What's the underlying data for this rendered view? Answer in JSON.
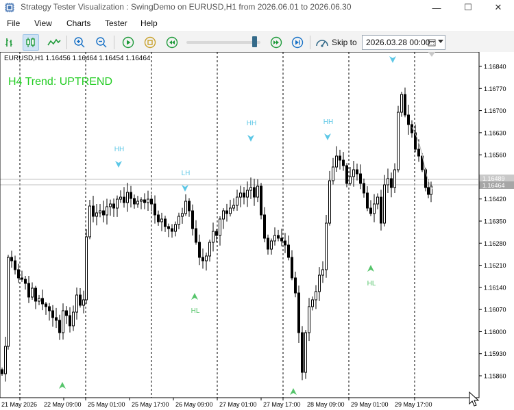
{
  "window": {
    "title": "Strategy Tester Visualization : SwingDemo on EURUSD,H1 from 2026.06.01 to 2026.06.30",
    "minimize_glyph": "—",
    "maximize_glyph": "☐",
    "close_glyph": "✕"
  },
  "menu": {
    "items": [
      "File",
      "View",
      "Charts",
      "Tester",
      "Help"
    ]
  },
  "toolbar": {
    "skip_label": "Skip to",
    "skip_date": "2026.03.28 00:00",
    "slider_position": 0.9
  },
  "chart": {
    "symbol_label": "EURUSD,H1  1.16456  1.16464  1.16454  1.16464",
    "trend_label": "H4 Trend: UPTREND",
    "price_labels": [
      "1.16840",
      "1.16770",
      "1.16700",
      "1.16630",
      "1.16560",
      "1.16490",
      "1.16420",
      "1.16350",
      "1.16280",
      "1.16210",
      "1.16140",
      "1.16070",
      "1.16000",
      "1.15930",
      "1.15860"
    ],
    "current_price": "1.16464",
    "bid_price": "1.16489",
    "time_labels": [
      "21 May 2026",
      "22 May 09:00",
      "25 May 01:00",
      "25 May 17:00",
      "26 May 09:00",
      "27 May 01:00",
      "27 May 17:00",
      "28 May 09:00",
      "29 May 01:00",
      "29 May 17:00"
    ],
    "markers": [
      {
        "type": "HH",
        "label": "HH"
      },
      {
        "type": "LH",
        "label": "LH"
      },
      {
        "type": "HH",
        "label": "HH"
      },
      {
        "type": "HH",
        "label": "HH"
      },
      {
        "type": "HL",
        "label": "HL"
      },
      {
        "type": "HL",
        "label": "HL"
      },
      {
        "type": "HH",
        "label": ""
      },
      {
        "type": "L",
        "label": ""
      },
      {
        "type": "L",
        "label": ""
      }
    ],
    "colors": {
      "bull": "#000000",
      "bear": "#000000",
      "trend": "#22cc22",
      "high_marker": "#5cc7e6",
      "low_marker": "#55c46a",
      "grid": "#000000",
      "price_line": "#c0c0c0"
    }
  }
}
